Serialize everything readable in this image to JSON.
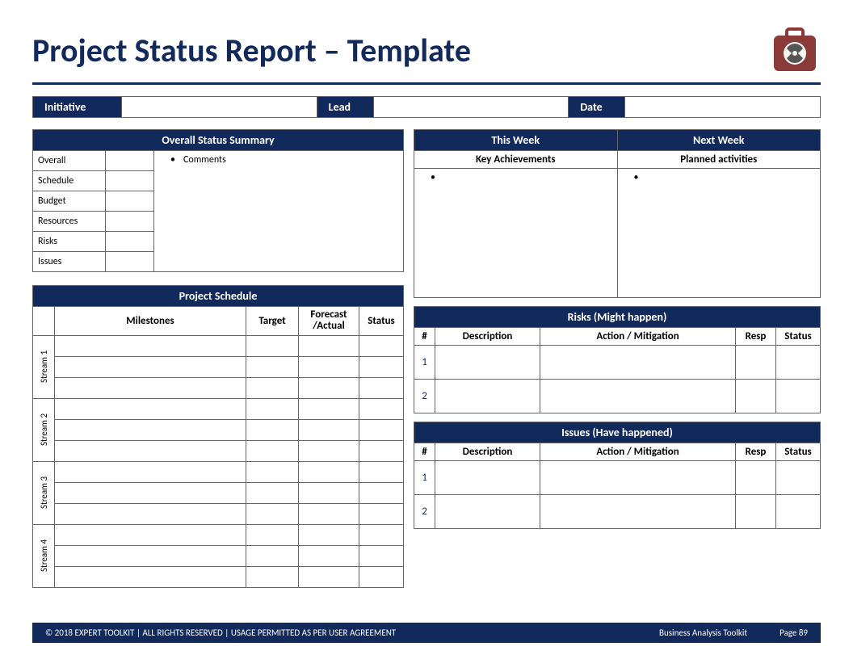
{
  "title": "Project Status Report – Template",
  "info": {
    "initiative_label": "Initiative",
    "initiative_value": "",
    "lead_label": "Lead",
    "lead_value": "",
    "date_label": "Date",
    "date_value": ""
  },
  "overall": {
    "header": "Overall Status Summary",
    "comments_bullet": "Comments",
    "rows": [
      "Overall",
      "Schedule",
      "Budget",
      "Resources",
      "Risks",
      "Issues"
    ]
  },
  "schedule": {
    "header": "Project Schedule",
    "cols": {
      "milestones": "Milestones",
      "target": "Target",
      "forecast": "Forecast /Actual",
      "status": "Status"
    },
    "streams": [
      "Stream 1",
      "Stream 2",
      "Stream 3",
      "Stream 4"
    ]
  },
  "week": {
    "this_week": "This Week",
    "next_week": "Next Week",
    "key_ach": "Key Achievements",
    "planned": "Planned activities"
  },
  "risks": {
    "header": "Risks (Might happen)",
    "cols": {
      "num": "#",
      "desc": "Description",
      "action": "Action / Mitigation",
      "resp": "Resp",
      "status": "Status"
    },
    "rows": [
      "1",
      "2"
    ]
  },
  "issues": {
    "header": "Issues (Have happened)",
    "cols": {
      "num": "#",
      "desc": "Description",
      "action": "Action / Mitigation",
      "resp": "Resp",
      "status": "Status"
    },
    "rows": [
      "1",
      "2"
    ]
  },
  "footer": {
    "left": "© 2018 EXPERT TOOLKIT | ALL RIGHTS RESERVED | USAGE PERMITTED AS PER USER AGREEMENT",
    "center": "Business Analysis Toolkit",
    "right": "Page 89"
  }
}
